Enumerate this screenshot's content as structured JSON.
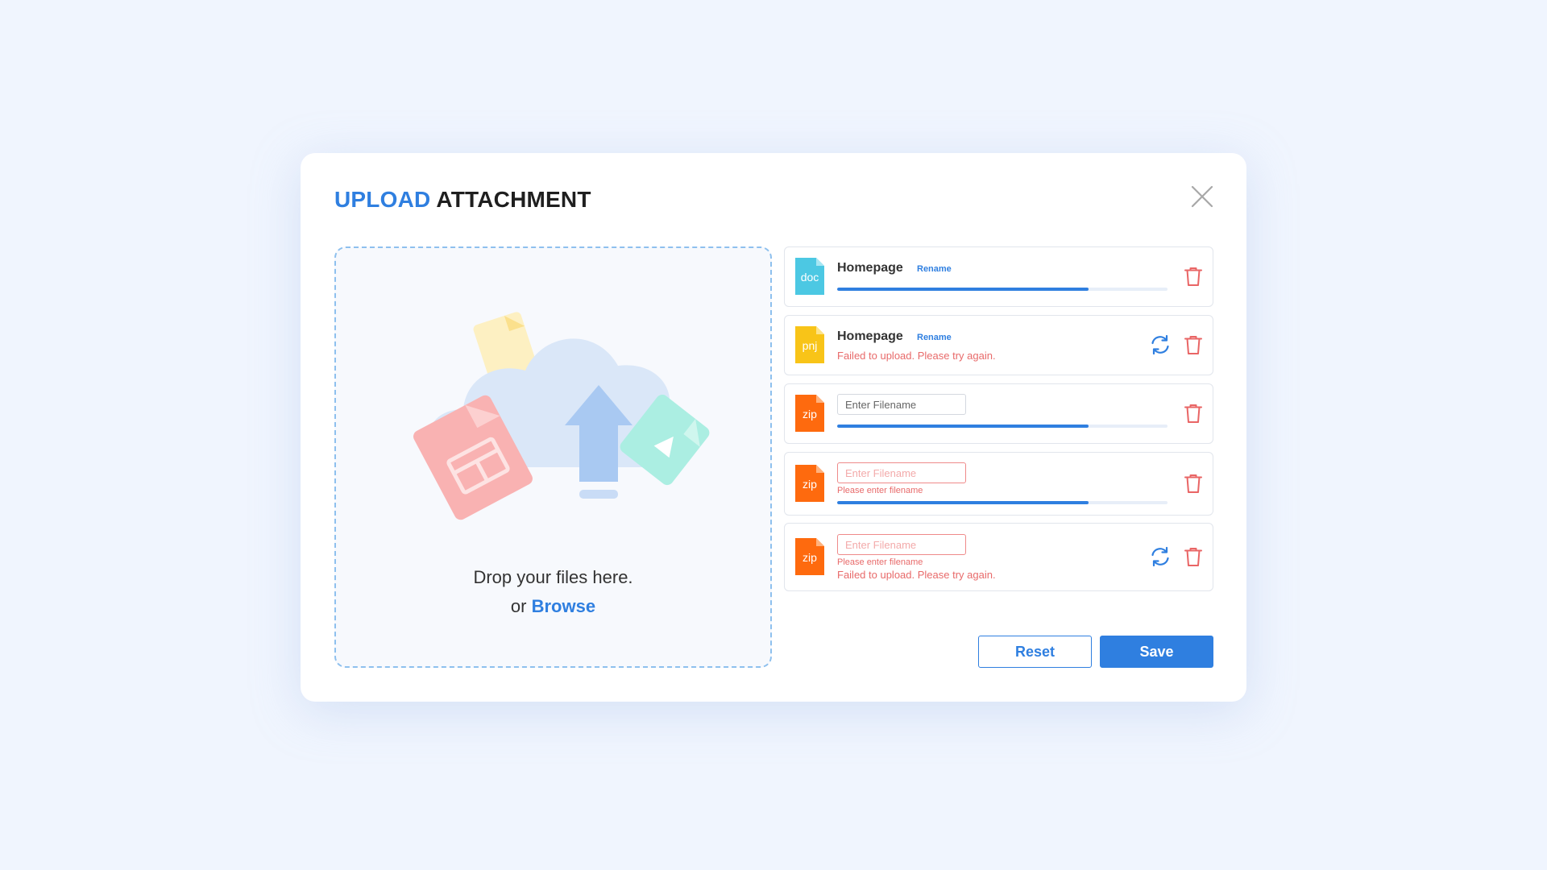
{
  "dialog": {
    "title_accent": "UPLOAD",
    "title_rest": "ATTACHMENT"
  },
  "dropzone": {
    "line1": "Drop your files here.",
    "or": "or",
    "browse": "Browse"
  },
  "files": [
    {
      "type": "doc",
      "name": "Homepage",
      "rename": "Rename",
      "progress": 0.76
    },
    {
      "type": "pnj",
      "name": "Homepage",
      "rename": "Rename",
      "error": "Failed to upload. Please try again."
    },
    {
      "type": "zip",
      "placeholder": "Enter Filename",
      "progress": 0.76
    },
    {
      "type": "zip",
      "placeholder": "Enter Filename",
      "validation": "Please enter filename",
      "progress": 0.76
    },
    {
      "type": "zip",
      "placeholder": "Enter Filename",
      "validation": "Please enter filename",
      "error": "Failed to upload. Please try again."
    }
  ],
  "buttons": {
    "reset": "Reset",
    "save": "Save"
  },
  "colors": {
    "accent": "#2f7fe0",
    "error": "#e86a6a",
    "doc": "#4cc8e3",
    "pnj": "#f8c418",
    "zip": "#fe6a0e"
  },
  "icons": {
    "close": "close-icon",
    "trash": "trash-icon",
    "retry": "refresh-icon",
    "upload": "cloud-upload-icon"
  }
}
